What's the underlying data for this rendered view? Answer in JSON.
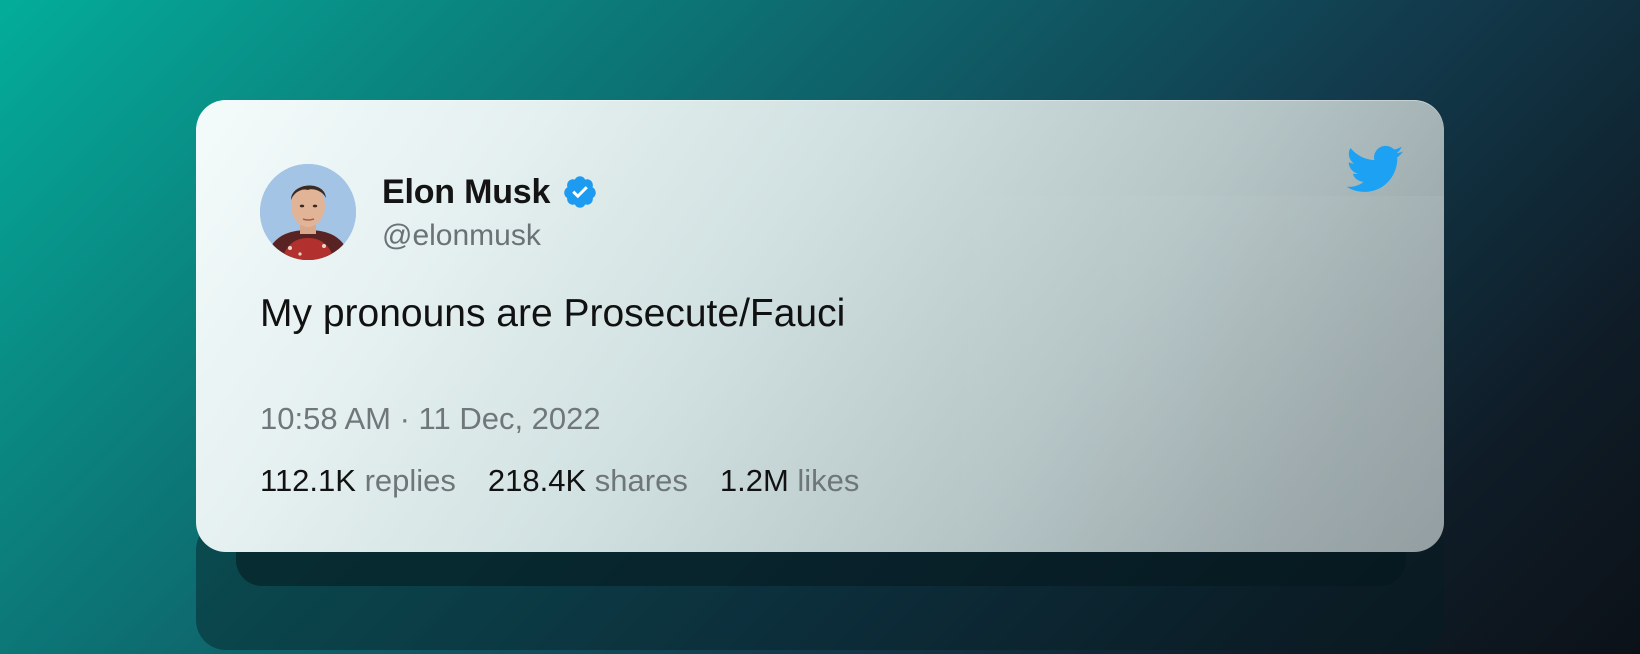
{
  "tweet": {
    "author": {
      "name": "Elon Musk",
      "handle": "@elonmusk",
      "verified": true,
      "avatar_icon": "avatar-photo"
    },
    "text": "My pronouns are Prosecute/Fauci",
    "timestamp": "10:58 AM · 11 Dec, 2022",
    "stats": [
      {
        "value": "112.1K",
        "label": "replies"
      },
      {
        "value": "218.4K",
        "label": "shares"
      },
      {
        "value": "1.2M",
        "label": "likes"
      }
    ],
    "brand_icon": "twitter-bird-icon"
  },
  "colors": {
    "twitter_blue": "#1da1f2",
    "verified_blue": "#1d9bf0",
    "background_start": "#03ad9a",
    "background_end": "#0c1118"
  }
}
